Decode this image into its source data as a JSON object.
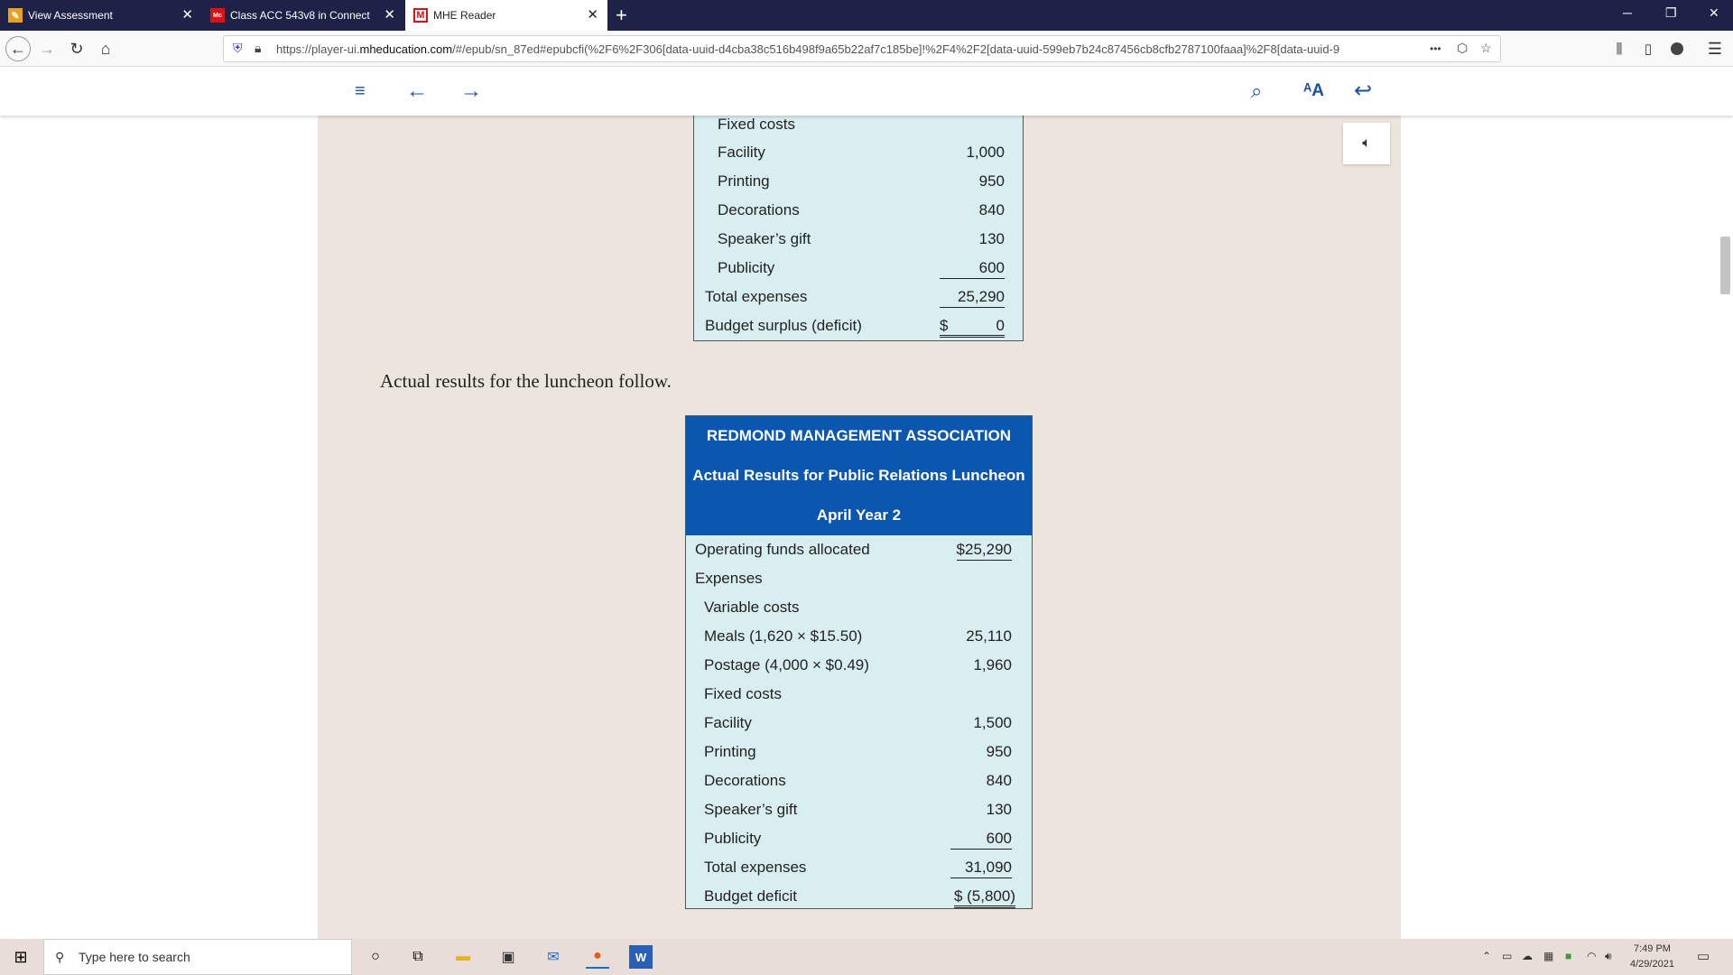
{
  "browser": {
    "tabs": [
      {
        "title": "View Assessment",
        "icon": "pencil-icon"
      },
      {
        "title": "Class ACC 543v8 in Connect",
        "icon": "mcgraw-hill-icon"
      },
      {
        "title": "MHE Reader",
        "icon": "mhe-m-icon"
      }
    ],
    "url_prefix": "https://player-ui.",
    "url_domain": "mheducation.com",
    "url_rest": "/#/epub/sn_87ed#epubcfi(%2F6%2F306[data-uuid-d4cba38c516b498f9a65b22af7c185be]!%2F4%2F2[data-uuid-599eb7b24c87456cb8cfb2787100faaa]%2F8[data-uuid-9",
    "menu_dots": "•••"
  },
  "reader": {
    "top_table": {
      "rows": [
        {
          "label": "Fixed costs",
          "value": ""
        },
        {
          "label": "Facility",
          "value": "1,000"
        },
        {
          "label": "Printing",
          "value": "950"
        },
        {
          "label": "Decorations",
          "value": "840"
        },
        {
          "label": "Speaker’s gift",
          "value": "130"
        },
        {
          "label": "Publicity",
          "value": "600"
        },
        {
          "label": "Total expenses",
          "value": "25,290"
        },
        {
          "label": "Budget surplus (deficit)",
          "currency": "$",
          "value": "0"
        }
      ]
    },
    "prose": "Actual results for the luncheon follow.",
    "actual_table": {
      "header": [
        "REDMOND MANAGEMENT ASSOCIATION",
        "Actual Results for Public Relations Luncheon",
        "April Year 2"
      ],
      "rows": [
        {
          "label": "Operating funds allocated",
          "value": "$25,290"
        },
        {
          "label": "Expenses",
          "value": ""
        },
        {
          "label": "Variable costs",
          "value": ""
        },
        {
          "label": "Meals (1,620 × $15.50)",
          "value": "25,110"
        },
        {
          "label": "Postage (4,000 × $0.49)",
          "value": "1,960"
        },
        {
          "label": "Fixed costs",
          "value": ""
        },
        {
          "label": "Facility",
          "value": "1,500"
        },
        {
          "label": "Printing",
          "value": "950"
        },
        {
          "label": "Decorations",
          "value": "840"
        },
        {
          "label": "Speaker’s gift",
          "value": "130"
        },
        {
          "label": "Publicity",
          "value": "600"
        },
        {
          "label": "Total expenses",
          "value": "31,090"
        },
        {
          "label": "Budget deficit",
          "value": "$ (5,800)"
        }
      ]
    }
  },
  "taskbar": {
    "search_placeholder": "Type here to search",
    "time": "7:49 PM",
    "date": "4/29/2021"
  },
  "colors": {
    "tab_bar": "#1f2247",
    "accent_blue": "#0b57b0",
    "table_bg": "#d9eef0",
    "page_bg": "#ebe5dd"
  }
}
